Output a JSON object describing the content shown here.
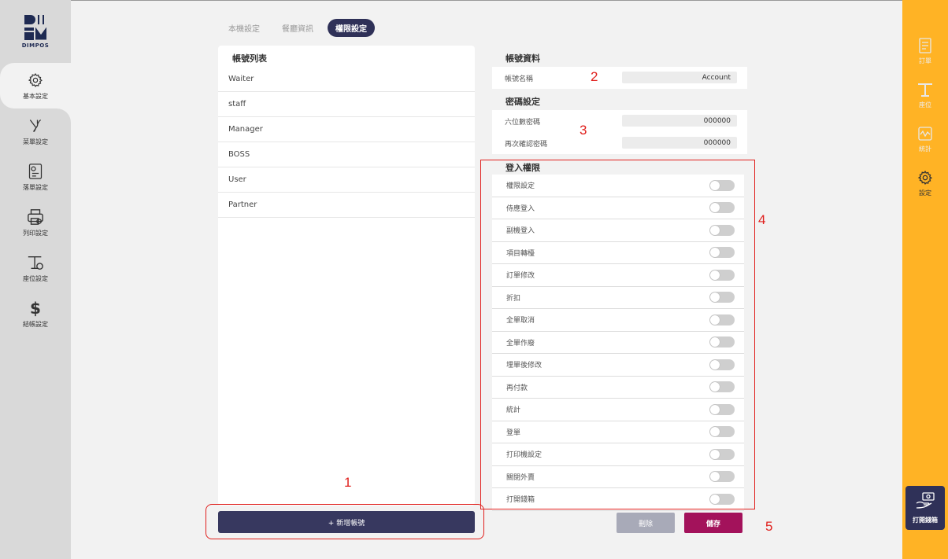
{
  "logo": {
    "text": "DIMPOS"
  },
  "left_nav": [
    {
      "label": "基本設定",
      "icon": "gear-icon"
    },
    {
      "label": "菜單設定",
      "icon": "utensils-icon"
    },
    {
      "label": "落單設定",
      "icon": "order-doc-icon"
    },
    {
      "label": "列印設定",
      "icon": "printer-icon"
    },
    {
      "label": "座位設定",
      "icon": "table-icon"
    },
    {
      "label": "結帳設定",
      "icon": "dollar-icon"
    }
  ],
  "tabs": [
    {
      "label": "本機設定"
    },
    {
      "label": "餐廳資訊"
    },
    {
      "label": "權限設定"
    }
  ],
  "account_list": {
    "title": "帳號列表",
    "items": [
      "Waiter",
      "staff",
      "Manager",
      "BOSS",
      "User",
      "Partner"
    ],
    "add_button": "+ 新增帳號"
  },
  "account_info": {
    "title": "帳號資料",
    "name_label": "帳號名稱",
    "name_value": "Account"
  },
  "password": {
    "title": "密碼設定",
    "pin_label": "六位數密碼",
    "pin_value": "000000",
    "confirm_label": "再次確認密碼",
    "confirm_value": "000000"
  },
  "permissions": {
    "title": "登入權限",
    "items": [
      "權限設定",
      "侍應登入",
      "副機登入",
      "項目轉檯",
      "訂單修改",
      "折扣",
      "全單取消",
      "全單作廢",
      "埋單後修改",
      "再付款",
      "統計",
      "登單",
      "打印機設定",
      "關閉外賣",
      "打開錢箱"
    ]
  },
  "actions": {
    "delete": "刪除",
    "save": "儲存"
  },
  "annotations": [
    "1",
    "2",
    "3",
    "4",
    "5"
  ],
  "right_nav": [
    {
      "label": "訂單",
      "icon": "receipt-icon"
    },
    {
      "label": "座位",
      "icon": "table-icon"
    },
    {
      "label": "統計",
      "icon": "stats-icon"
    },
    {
      "label": "設定",
      "icon": "gear-icon"
    }
  ],
  "cash_drawer": {
    "label": "打開錢箱"
  },
  "colors": {
    "sidebar": "#d9d9d9",
    "accent_nav": "#ffb325",
    "primary": "#37385f",
    "save": "#a3125b",
    "annotation": "#e0201d"
  }
}
